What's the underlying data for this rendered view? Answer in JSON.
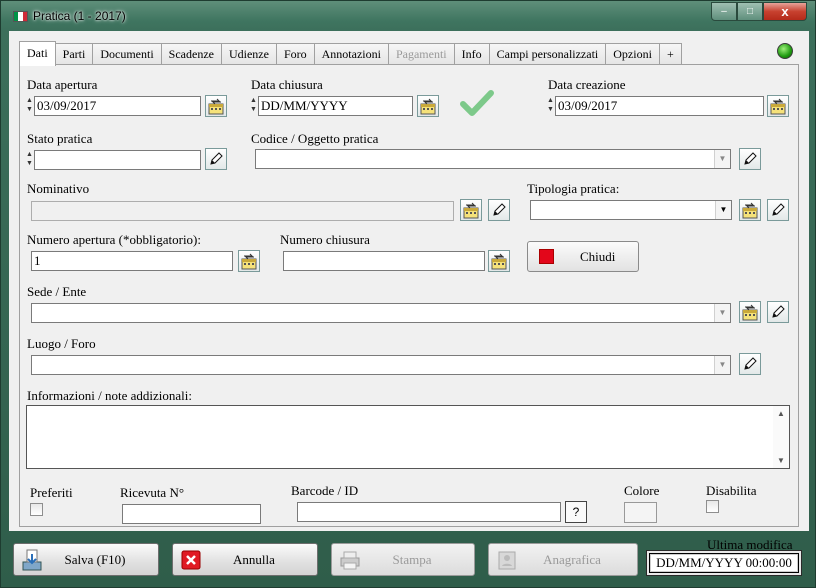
{
  "window": {
    "title": "Pratica (1 - 2017)",
    "buttons": {
      "minimize": "‒",
      "maximize": "□",
      "close": "x"
    }
  },
  "tabs": [
    {
      "label": "Dati",
      "active": true
    },
    {
      "label": "Parti"
    },
    {
      "label": "Documenti"
    },
    {
      "label": "Scadenze"
    },
    {
      "label": "Udienze"
    },
    {
      "label": "Foro"
    },
    {
      "label": "Annotazioni"
    },
    {
      "label": "Pagamenti",
      "disabled": true
    },
    {
      "label": "Info"
    },
    {
      "label": "Campi personalizzati"
    },
    {
      "label": "Opzioni"
    },
    {
      "label": "+"
    }
  ],
  "form": {
    "data_apertura": {
      "label": "Data apertura",
      "value": "03/09/2017"
    },
    "data_chiusura": {
      "label": "Data chiusura",
      "value": "DD/MM/YYYY"
    },
    "data_creazione": {
      "label": "Data creazione",
      "value": "03/09/2017"
    },
    "stato_pratica": {
      "label": "Stato pratica",
      "value": ""
    },
    "codice_oggetto": {
      "label": "Codice / Oggetto pratica",
      "value": ""
    },
    "nominativo": {
      "label": "Nominativo",
      "value": ""
    },
    "tipologia": {
      "label": "Tipologia pratica:",
      "value": ""
    },
    "numero_apertura": {
      "label": "Numero apertura (*obbligatorio):",
      "value": "1"
    },
    "numero_chiusura": {
      "label": "Numero chiusura",
      "value": ""
    },
    "chiudi_button": "Chiudi",
    "sede_ente": {
      "label": "Sede / Ente",
      "value": ""
    },
    "luogo_foro": {
      "label": "Luogo / Foro",
      "value": ""
    },
    "informazioni": {
      "label": "Informazioni / note addizionali:",
      "value": ""
    },
    "preferiti": {
      "label": "Preferiti",
      "checked": false
    },
    "ricevuta": {
      "label": "Ricevuta N°",
      "value": ""
    },
    "barcode": {
      "label": "Barcode / ID",
      "value": "",
      "help_button": "?"
    },
    "colore": {
      "label": "Colore"
    },
    "disabilita": {
      "label": "Disabilita",
      "checked": false
    }
  },
  "actions": {
    "salva": "Salva (F10)",
    "annulla": "Annulla",
    "stampa": "Stampa",
    "anagrafica": "Anagrafica"
  },
  "last_modified": {
    "label": "Ultima modifica",
    "value": "DD/MM/YYYY 00:00:00"
  },
  "colors": {
    "accent_green": "#2f5d4a",
    "status_ok": "#1f9a10",
    "chiudi_red": "#e3061a"
  }
}
